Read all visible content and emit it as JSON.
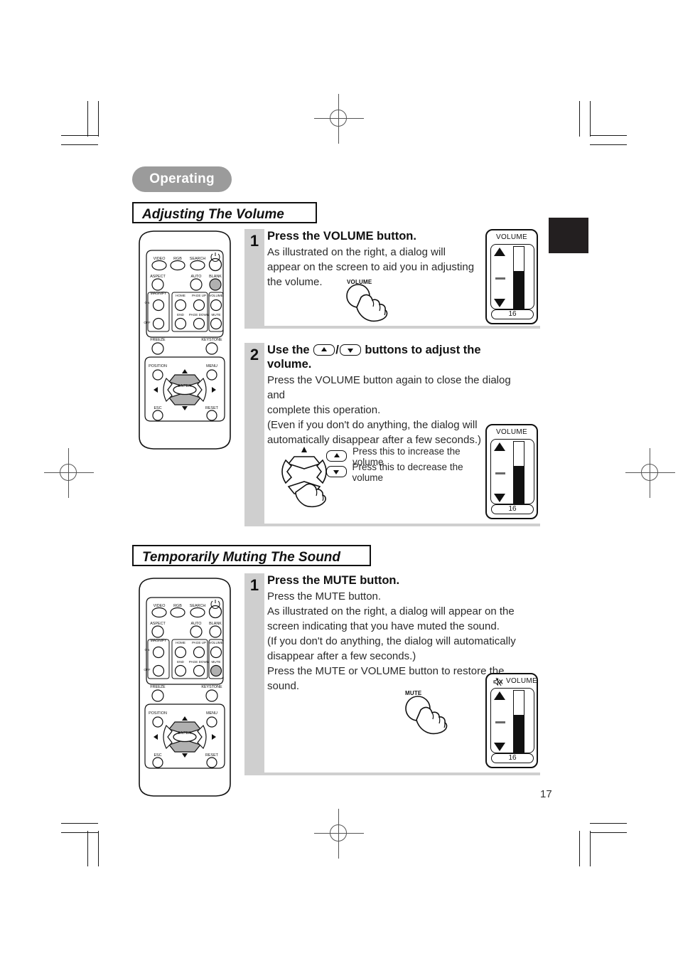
{
  "document": {
    "page_number": "17",
    "chapter_tag": "Operating"
  },
  "sections": [
    {
      "title": "Adjusting The Volume",
      "steps": [
        {
          "number": "1",
          "heading": "Press the VOLUME button.",
          "lines": [
            "As illustrated on the right, a dialog will",
            "appear on the screen to aid you in adjusting",
            "the volume."
          ],
          "hand_label": "VOLUME"
        },
        {
          "number": "2",
          "heading_part1": "Use the",
          "heading_part2": "buttons to adjust the",
          "heading_part3": "volume.",
          "lines": [
            "Press the VOLUME button again to close the dialog and",
            "complete this operation.",
            "(Even if you don't do anything, the dialog will",
            "automatically disappear after a few seconds.)"
          ],
          "legend": [
            {
              "icon": "up-arrow-pill-icon",
              "text": "Press this to increase the volume"
            },
            {
              "icon": "down-arrow-pill-icon",
              "text": "Press this to decrease the volume"
            }
          ]
        }
      ]
    },
    {
      "title": "Temporarily Muting The Sound",
      "steps": [
        {
          "number": "1",
          "heading": "Press the MUTE button.",
          "lines": [
            "Press the MUTE button.",
            "As illustrated on the right, a dialog will appear on the",
            "screen indicating that you have muted the sound.",
            "(If you don't do anything, the dialog will automatically",
            "disappear after a few seconds.)",
            "Press the MUTE or VOLUME button to restore the sound."
          ],
          "hand_label": "MUTE"
        }
      ]
    }
  ],
  "osd_dialogs": [
    {
      "title": "VOLUME",
      "value": "16",
      "muted": false,
      "fill_percent": 62
    },
    {
      "title": "VOLUME",
      "value": "16",
      "muted": false,
      "fill_percent": 62
    },
    {
      "title": "VOLUME",
      "value": "16",
      "muted": true,
      "fill_percent": 62
    }
  ],
  "remote_buttons": {
    "row1": [
      "VIDEO",
      "RGB",
      "SEARCH"
    ],
    "power": "STANDBY/ON",
    "row2_left": "ASPECT",
    "row2_mid": "AUTO",
    "row2_right": "BLANK",
    "magnify": "MAGNIFY",
    "magnify_on": "ON",
    "magnify_off": "OFF",
    "page_home": "HOME",
    "page_up": "PAGE UP",
    "page_end": "END",
    "page_down": "PAGE DOWN",
    "volume": "VOLUME",
    "mute": "MUTE",
    "freeze": "FREEZE",
    "keystone": "KEYSTONE",
    "position": "POSITION",
    "menu": "MENU",
    "enter": "ENTER",
    "esc": "ESC",
    "reset": "RESET"
  },
  "remote_highlight": {
    "first": "BLANK",
    "second": "MUTE"
  },
  "colors": {
    "chapter_tag_bg": "#9b9b9b",
    "step_band": "#cfcfcf",
    "ink": "#111111",
    "thumb_tab": "#231f20",
    "highlight_button": "#b0b0b0"
  }
}
